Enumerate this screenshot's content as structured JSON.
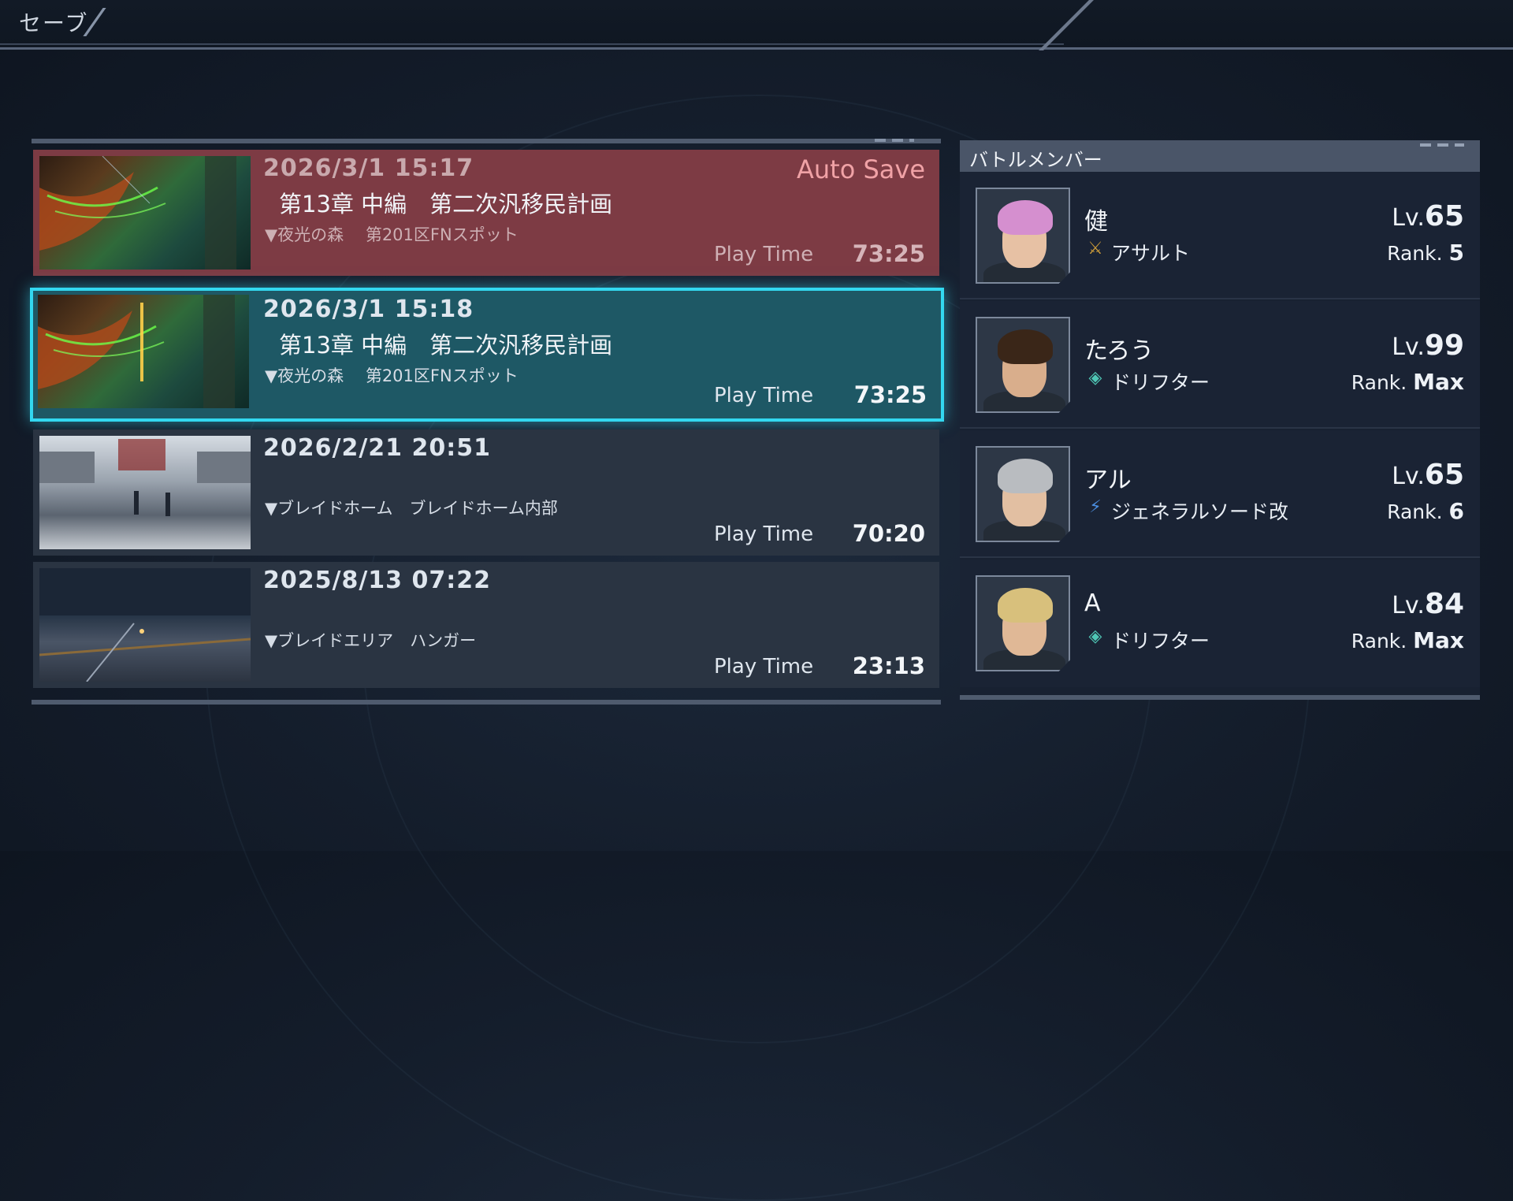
{
  "header": {
    "title": "セーブ"
  },
  "saves": [
    {
      "date": "2026/3/1 15:17",
      "badge": "Auto Save",
      "chapter": "第13章 中編　第二次汎移民計画",
      "location": "▼夜光の森　 第201区FNスポット",
      "play_time_label": "Play Time",
      "play_time": "73:25",
      "thumb": "forest"
    },
    {
      "date": "2026/3/1 15:18",
      "chapter": "第13章 中編　第二次汎移民計画",
      "location": "▼夜光の森　 第201区FNスポット",
      "play_time_label": "Play Time",
      "play_time": "73:25",
      "thumb": "forest"
    },
    {
      "date": "2026/2/21 20:51",
      "chapter": "",
      "location": "▼ブレイドホーム　ブレイドホーム内部",
      "play_time_label": "Play Time",
      "play_time": "70:20",
      "thumb": "home"
    },
    {
      "date": "2025/8/13 07:22",
      "chapter": "",
      "location": "▼ブレイドエリア　ハンガー",
      "play_time_label": "Play Time",
      "play_time": "23:13",
      "thumb": "hangar"
    }
  ],
  "party": {
    "title": "バトルメンバー",
    "members": [
      {
        "name": "健",
        "class": "アサルト",
        "class_icon": "assault-icon",
        "lv_label": "Lv.",
        "lv": "65",
        "rank_label": "Rank.",
        "rank": "5",
        "hair_color": "#d58fcf"
      },
      {
        "name": "たろう",
        "class": "ドリフター",
        "class_icon": "drifter-icon",
        "lv_label": "Lv.",
        "lv": "99",
        "rank_label": "Rank.",
        "rank": "Max",
        "hair_color": "#3a2618"
      },
      {
        "name": "アル",
        "class": "ジェネラルソード改",
        "class_icon": "general-sword-icon",
        "lv_label": "Lv.",
        "lv": "65",
        "rank_label": "Rank.",
        "rank": "6",
        "hair_color": "#b9bcc0"
      },
      {
        "name": "A",
        "class": "ドリフター",
        "class_icon": "drifter-icon",
        "lv_label": "Lv.",
        "lv": "84",
        "rank_label": "Rank.",
        "rank": "Max",
        "hair_color": "#d8c07c"
      }
    ]
  },
  "colors": {
    "auto_save_bg": "#7d3b44",
    "selected_bg": "#1e5865",
    "selected_border": "#33d8f0",
    "slot_bg": "#2a3442"
  }
}
